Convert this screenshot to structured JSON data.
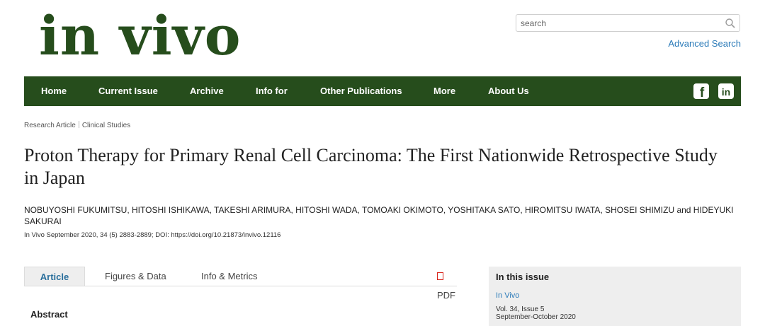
{
  "logo": {
    "text": "in vivo"
  },
  "search": {
    "placeholder": "search",
    "advanced_label": "Advanced Search"
  },
  "nav": {
    "items": [
      "Home",
      "Current Issue",
      "Archive",
      "Info for",
      "Other Publications",
      "More",
      "About Us"
    ]
  },
  "social": {
    "facebook": "f",
    "linkedin": "in"
  },
  "breadcrumb": {
    "type": "Research Article",
    "section": "Clinical Studies"
  },
  "article": {
    "title": "Proton Therapy for Primary Renal Cell Carcinoma: The First Nationwide Retrospective Study in Japan",
    "authors": "NOBUYOSHI FUKUMITSU, HITOSHI ISHIKAWA, TAKESHI ARIMURA, HITOSHI WADA, TOMOAKI OKIMOTO, YOSHITAKA SATO, HIROMITSU IWATA, SHOSEI SHIMIZU and HIDEYUKI SAKURAI",
    "citation": "In Vivo September 2020, 34 (5) 2883-2889; DOI: https://doi.org/10.21873/invivo.12116"
  },
  "tabs": {
    "article": "Article",
    "figures": "Figures & Data",
    "info": "Info & Metrics",
    "pdf": "PDF"
  },
  "abstract_heading": "Abstract",
  "sidebar": {
    "heading": "In this issue",
    "journal_link": "In Vivo",
    "volume": "Vol. 34, Issue 5",
    "date": "September-October 2020"
  }
}
